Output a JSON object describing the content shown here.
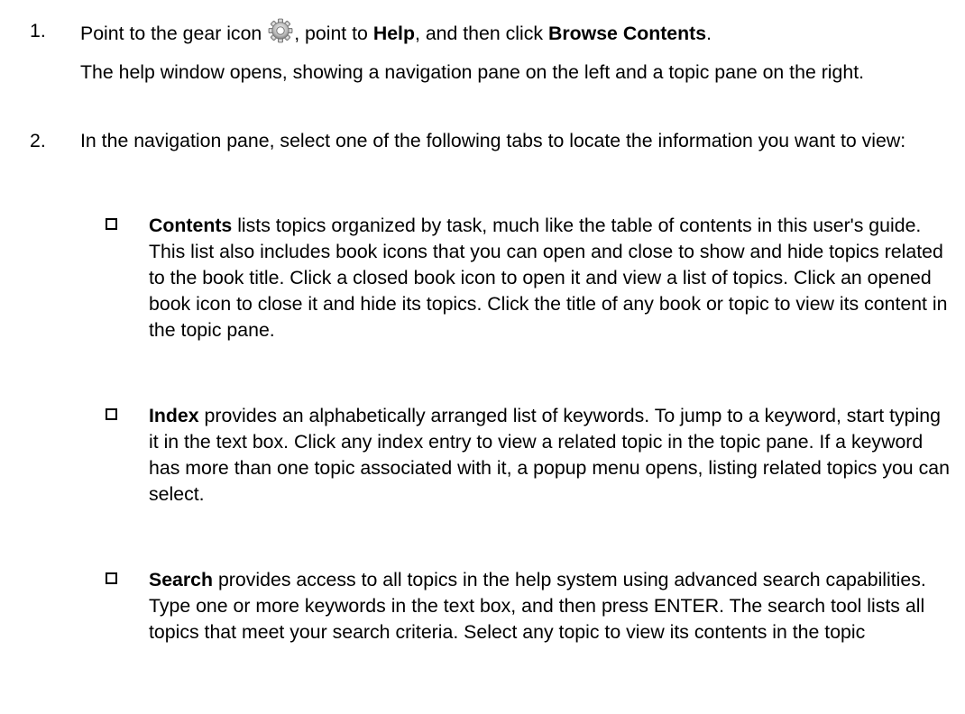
{
  "step1": {
    "number": "1.",
    "text_a": "Point to the gear icon",
    "text_b": ", point to ",
    "bold_help": "Help",
    "text_c": ", and then click ",
    "bold_browse": "Browse Contents",
    "text_d": ".",
    "gear_icon": "gear-icon",
    "result": "The help window opens, showing a navigation pane on the left and a topic pane on the right."
  },
  "step2": {
    "number": "2.",
    "text": "In the navigation pane, select one of the following tabs to locate the information you want to view:",
    "bullets": [
      {
        "term": "Contents",
        "desc": " lists topics organized by task, much like the table of contents in this user's guide. This list also includes book icons that you can open and close to show and hide topics related to the book title. Click a closed book icon to open it and view a list of topics. Click an opened book icon to close it and hide its topics. Click the title of any book or topic to view its content in the topic pane."
      },
      {
        "term": "Index",
        "desc": " provides an alphabetically arranged list of keywords. To jump to a keyword, start typing it in the text box. Click any index entry to view a related topic in the topic pane. If a keyword has more than one topic associated with it, a popup menu opens, listing related topics you can select."
      },
      {
        "term": "Search",
        "desc": " provides access to all topics in the help system using advanced search capabilities. Type one or more keywords in the text box, and then press ENTER. The search tool lists all topics that meet your search criteria. Select any topic to view its contents in the topic"
      }
    ]
  }
}
